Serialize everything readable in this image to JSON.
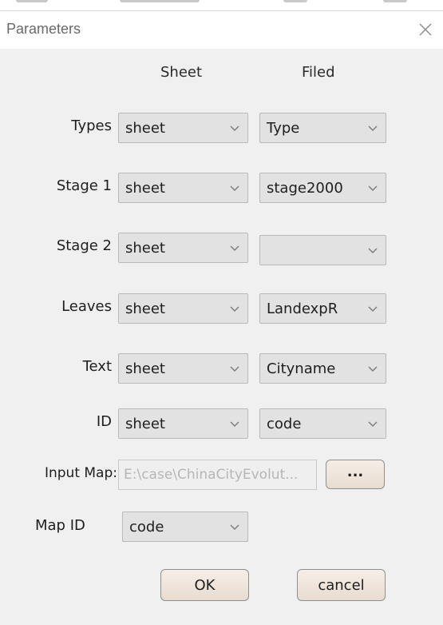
{
  "dialog": {
    "title": "Parameters"
  },
  "columns": {
    "sheet": "Sheet",
    "field": "Filed"
  },
  "rows": [
    {
      "label": "Types",
      "sheet": "sheet",
      "field": "Type"
    },
    {
      "label": "Stage 1",
      "sheet": "sheet",
      "field": "stage2000"
    },
    {
      "label": "Stage 2",
      "sheet": "sheet",
      "field": ""
    },
    {
      "label": "Leaves",
      "sheet": "sheet",
      "field": "LandexpR"
    },
    {
      "label": "Text",
      "sheet": "sheet",
      "field": "Cityname"
    },
    {
      "label": "ID",
      "sheet": "sheet",
      "field": "code"
    }
  ],
  "input_map": {
    "label": "Input Map:",
    "value": "E:\\case\\ChinaCityEvolut...",
    "browse_label": "..."
  },
  "map_id": {
    "label": "Map ID",
    "value": "code"
  },
  "buttons": {
    "ok": "OK",
    "cancel": "cancel"
  },
  "icons": {
    "close": "close-icon",
    "dropdown": "chevron-down-icon"
  }
}
